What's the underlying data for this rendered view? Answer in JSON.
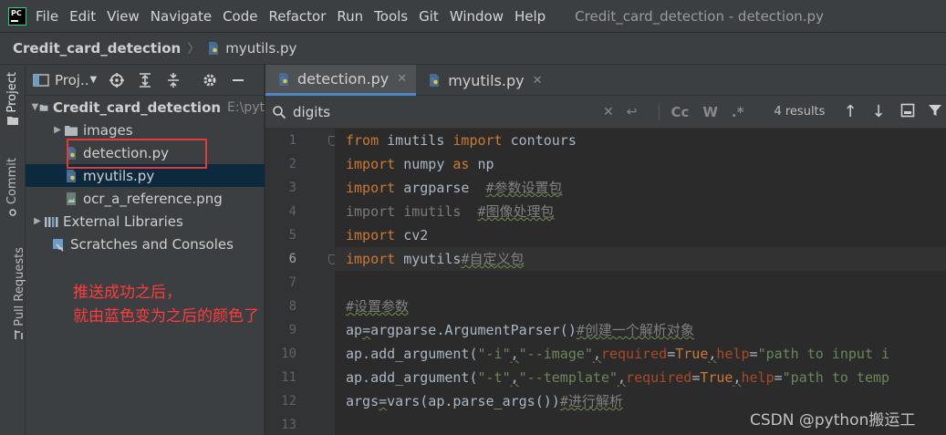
{
  "menubar": {
    "logo_text": "PC",
    "items": [
      "File",
      "Edit",
      "View",
      "Navigate",
      "Code",
      "Refactor",
      "Run",
      "Tools",
      "Git",
      "Window",
      "Help"
    ],
    "window_title": "Credit_card_detection - detection.py"
  },
  "navbar": {
    "project": "Credit_card_detection",
    "file": "myutils.py"
  },
  "toolstrip": {
    "tabs": [
      "Project",
      "Commit",
      "Pull Requests"
    ]
  },
  "project_panel": {
    "title": "Proj..",
    "root": {
      "name": "Credit_card_detection",
      "path": "E:\\pyt"
    },
    "items": [
      {
        "name": "images",
        "type": "folder"
      },
      {
        "name": "detection.py",
        "type": "python"
      },
      {
        "name": "myutils.py",
        "type": "python"
      },
      {
        "name": "ocr_a_reference.png",
        "type": "image"
      }
    ],
    "external_libraries": "External Libraries",
    "scratches": "Scratches and Consoles",
    "annotation_line1": "推送成功之后，",
    "annotation_line2": "就由蓝色变为之后的颜色了"
  },
  "editor": {
    "tabs": [
      {
        "label": "detection.py",
        "active": true
      },
      {
        "label": "myutils.py",
        "active": false
      }
    ],
    "search": {
      "value": "digits",
      "results": "4 results",
      "case_label": "Cc",
      "word_label": "W",
      "regex_label": ".*"
    },
    "current_line": 6,
    "line_numbers": [
      "1",
      "2",
      "3",
      "4",
      "5",
      "6",
      "7",
      "8",
      "9",
      "10",
      "11",
      "12",
      "13"
    ],
    "code": {
      "l1": {
        "kw1": "from",
        "mod": " imutils ",
        "kw2": "import",
        "name": " contours"
      },
      "l2": {
        "kw1": "import",
        "mod": " numpy ",
        "kw2": "as",
        "name": " np"
      },
      "l3": {
        "kw": "import",
        "mod": " argparse  ",
        "comment": "#参数设置包"
      },
      "l4": {
        "text": "import imutils  ",
        "comment": "#图像处理包"
      },
      "l5": {
        "kw": "import",
        "mod": " cv2"
      },
      "l6": {
        "kw": "import",
        "mod": " myutils",
        "comment": "#自定义包"
      },
      "l8": {
        "comment": "#设置参数"
      },
      "l9": {
        "var": "ap",
        "eq": "=",
        "call": "argparse.ArgumentParser()",
        "comment": "#创建一个解析对象"
      },
      "l10": {
        "pre": "ap.add_argument(",
        "s1": "\"-i\"",
        "c1": ",",
        "s2": "\"--image\"",
        "c2": ",",
        "kw": "required",
        "eq": "=",
        "true": "True",
        "c3": ",",
        "kw2": "help",
        "eq2": "=",
        "s3": "\"path to input i"
      },
      "l11": {
        "pre": "ap.add_argument(",
        "s1": "\"-t\"",
        "c1": ",",
        "s2": "\"--template\"",
        "c2": ",",
        "kw": "required",
        "eq": "=",
        "true": "True",
        "c3": ",",
        "kw2": "help",
        "eq2": "=",
        "s3": "\"path to temp"
      },
      "l12": {
        "var": "args",
        "eq": "=",
        "call": "vars(ap.parse_args())",
        "comment": "#进行解析"
      }
    }
  },
  "watermark": "CSDN @python搬运工"
}
